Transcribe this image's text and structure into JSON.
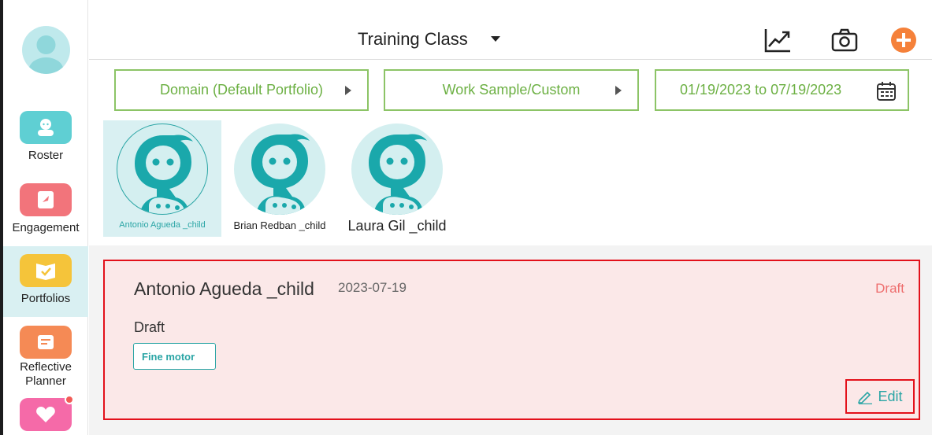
{
  "sidebar": {
    "items": [
      {
        "label": "Roster",
        "icon": "roster-icon",
        "color": "#5fcfd3"
      },
      {
        "label": "Engagement",
        "icon": "engagement-icon",
        "color": "#f2747b"
      },
      {
        "label": "Portfolios",
        "icon": "portfolios-icon",
        "color": "#f5c43a",
        "active": true
      },
      {
        "label": "Reflective Planner",
        "icon": "planner-icon",
        "color": "#f58a55"
      },
      {
        "label": "",
        "icon": "heart-icon",
        "color": "#f56aa8"
      }
    ]
  },
  "header": {
    "title": "Training Class",
    "icons": [
      "chart-icon",
      "camera-icon",
      "add-icon"
    ]
  },
  "filters": {
    "domain": "Domain (Default Portfolio)",
    "type": "Work Sample/Custom",
    "date_range": "01/19/2023 to 07/19/2023"
  },
  "children": [
    {
      "name": "Antonio Agueda _child",
      "selected": true
    },
    {
      "name": "Brian Redban _child",
      "selected": false
    },
    {
      "name": "Laura Gil _child",
      "selected": false
    }
  ],
  "entry": {
    "name": "Antonio Agueda _child",
    "date": "2023-07-19",
    "status": "Draft",
    "text": "Draft",
    "tag": "Fine motor",
    "edit_label": "Edit"
  },
  "colors": {
    "accent": "#2aa5a5",
    "filter_border": "#8cc466",
    "highlight": "#e3111b",
    "add_button": "#f5813a"
  }
}
